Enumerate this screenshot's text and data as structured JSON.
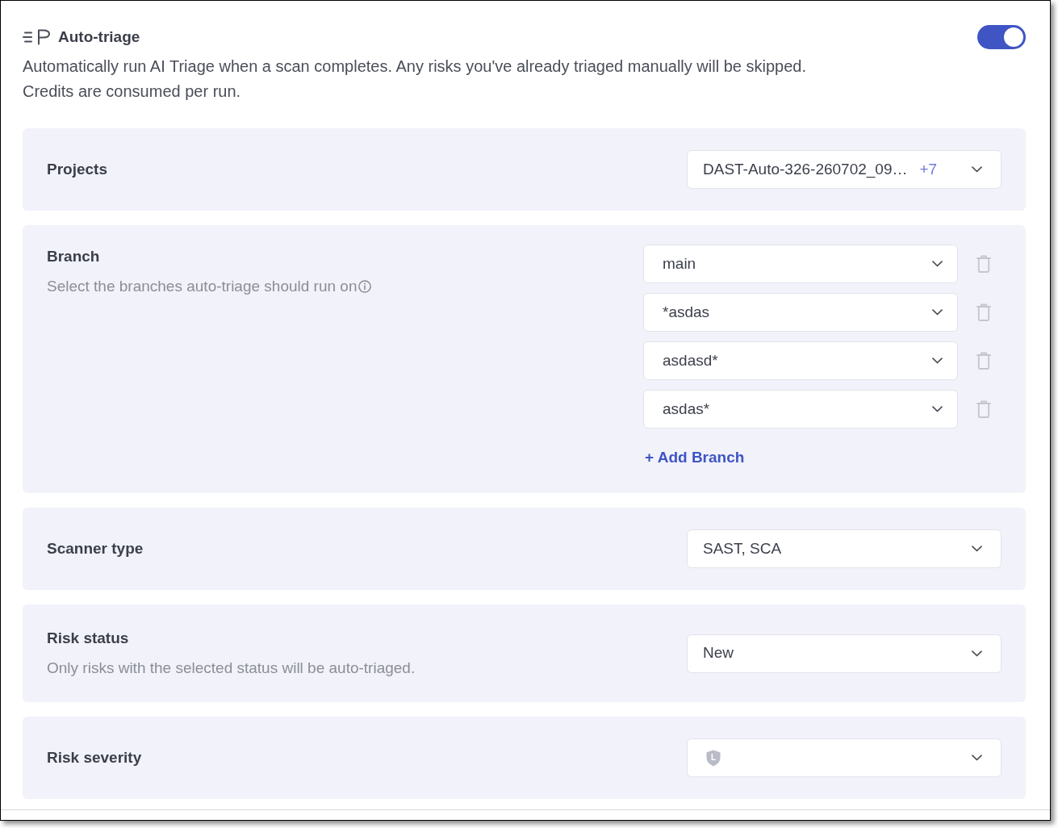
{
  "header": {
    "title": "Auto-triage",
    "enabled": true,
    "description_lines": [
      "Automatically run AI Triage when a scan completes. Any risks you've already triaged manually will be skipped.",
      "Credits are consumed per run."
    ]
  },
  "sections": [
    {
      "kind": "select",
      "label": "Projects",
      "value": "DAST-Auto-326-260702_09…",
      "extra_count": "+7"
    },
    {
      "kind": "branches",
      "label": "Branch",
      "description": "Select the branches auto-triage should run on",
      "branches": [
        "main",
        "*asdas",
        "asdasd*",
        "asdas*"
      ],
      "add_button": "+ Add Branch"
    },
    {
      "kind": "select",
      "label": "Scanner type",
      "value": "SAST, SCA"
    },
    {
      "kind": "select",
      "label": "Risk status",
      "description": "Only risks with the selected status will be auto-triaged.",
      "value": "New"
    },
    {
      "kind": "severity",
      "label": "Risk severity",
      "badges": [
        "L"
      ]
    }
  ]
}
